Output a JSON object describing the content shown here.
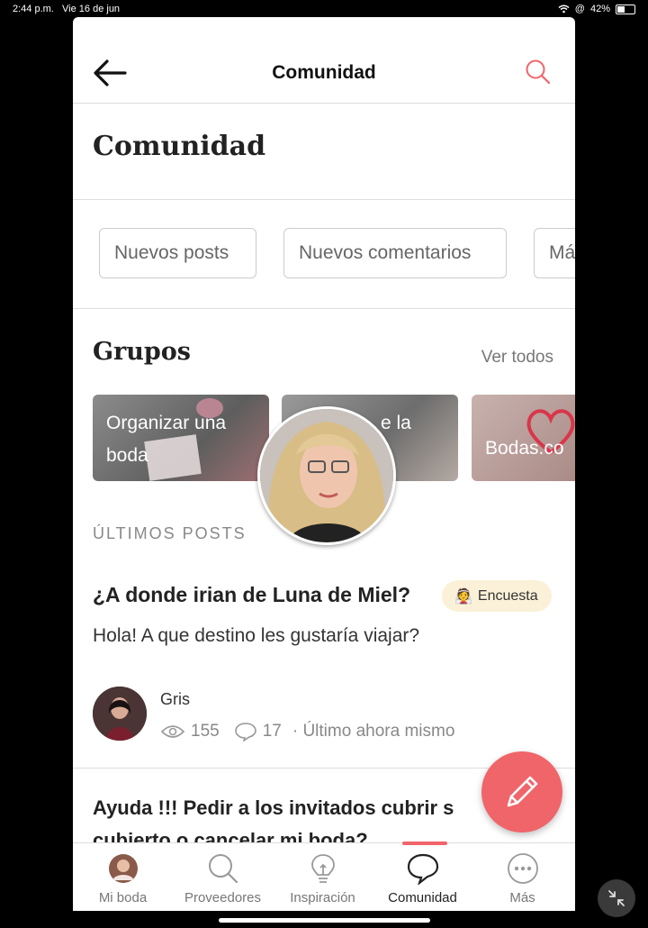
{
  "status": {
    "time": "2:44 p.m.",
    "date": "Vie 16 de jun",
    "battery": "42%"
  },
  "header": {
    "title": "Comunidad"
  },
  "hero": {
    "title": "Comunidad"
  },
  "filters": [
    "Nuevos posts",
    "Nuevos comentarios",
    "Má"
  ],
  "groups": {
    "title": "Grupos",
    "link": "Ver todos",
    "cards": [
      {
        "label": "Organizar una boda"
      },
      {
        "label": "e la"
      },
      {
        "label": "Bodas.co"
      }
    ]
  },
  "latest": {
    "label": "ÚLTIMOS POSTS",
    "post": {
      "title": "¿A donde irian de Luna de Miel?",
      "badge": "Encuesta",
      "body": "Hola! A que destino les gustaría viajar?",
      "author": "Gris",
      "views": "155",
      "comments": "17",
      "time": "· Último ahora mismo"
    },
    "post2": {
      "title": "Ayuda !!! Pedir a los invitados cubrir s cubierto o cancelar mi boda?"
    }
  },
  "tabs": [
    {
      "label": "Mi boda",
      "icon": "avatar-icon"
    },
    {
      "label": "Proveedores",
      "icon": "search-icon"
    },
    {
      "label": "Inspiración",
      "icon": "lightbulb-icon"
    },
    {
      "label": "Comunidad",
      "icon": "chat-bubble-icon",
      "active": true
    },
    {
      "label": "Más",
      "icon": "more-icon"
    }
  ],
  "colors": {
    "accent": "#f0656a",
    "badge_bg": "#fbf1d8"
  }
}
